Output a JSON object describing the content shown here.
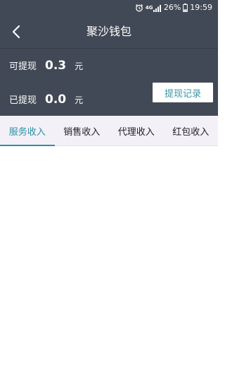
{
  "status_bar": {
    "network": "4G",
    "battery": "26%",
    "time": "19:59",
    "icons": [
      "alarm-icon",
      "network-4g-icon",
      "signal-icon",
      "battery-icon"
    ]
  },
  "header": {
    "title": "聚沙钱包",
    "back_icon": "chevron-left-icon"
  },
  "balance": {
    "withdrawable_label": "可提现",
    "withdrawable_amount": "0.3",
    "withdrawable_unit": "元",
    "withdrawn_label": "已提现",
    "withdrawn_amount": "0.0",
    "withdrawn_unit": "元",
    "records_button": "提现记录"
  },
  "tabs": [
    {
      "label": "服务收入",
      "active": true
    },
    {
      "label": "销售收入",
      "active": false
    },
    {
      "label": "代理收入",
      "active": false
    },
    {
      "label": "红包收入",
      "active": false
    }
  ],
  "colors": {
    "header_bg": "#424956",
    "accent": "#2e8fa3",
    "tab_bar_bg": "#f3f0f8"
  }
}
